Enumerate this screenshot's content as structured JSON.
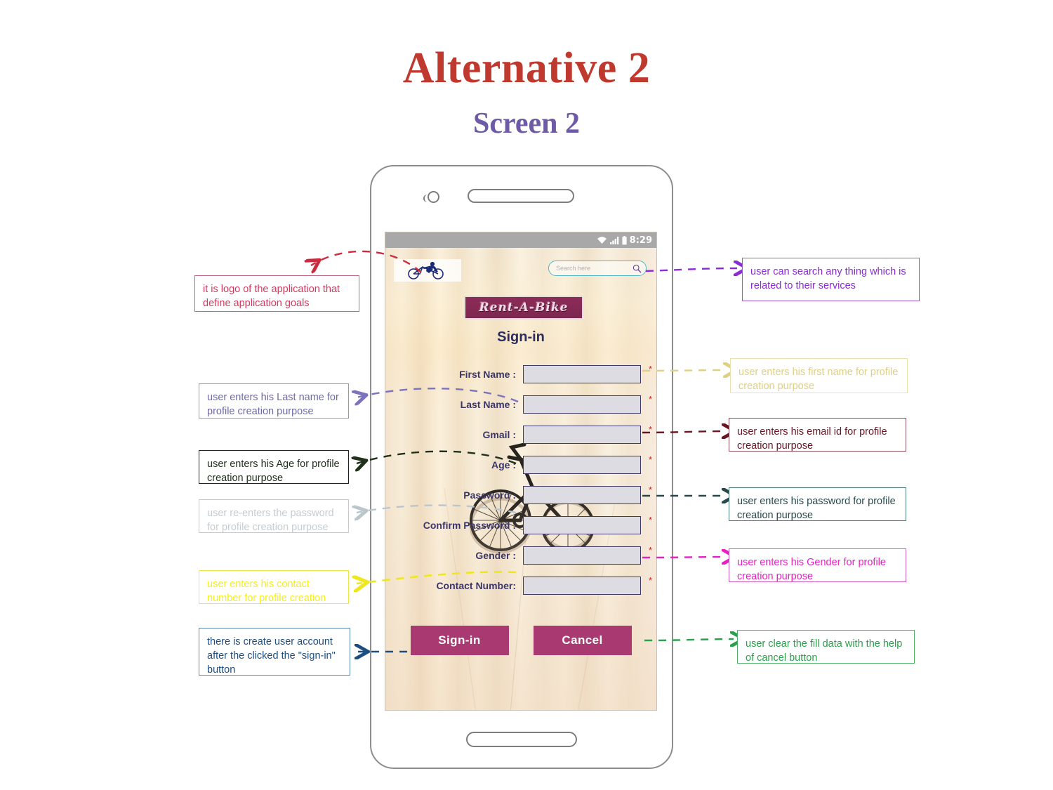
{
  "header": {
    "title": "Alternative 2",
    "subtitle": "Screen 2",
    "title_color": "#c0392f",
    "subtitle_color": "#6f5aa6"
  },
  "phone": {
    "status_bar": {
      "time": "8:29",
      "icons": [
        "wifi-icon",
        "signal-icon",
        "battery-icon"
      ]
    },
    "app": {
      "logo_icon": "bicycle-logo-icon",
      "search": {
        "placeholder": "Search here",
        "icon": "search-icon"
      },
      "banner_title": "Rent-A-Bike",
      "banner_color": "#8d2c58",
      "screen_title": "Sign-in",
      "form_fields": [
        {
          "label": "First Name :",
          "value": "",
          "required": "*"
        },
        {
          "label": "Last Name :",
          "value": "",
          "required": "*"
        },
        {
          "label": "Gmail :",
          "value": "",
          "required": "*"
        },
        {
          "label": "Age :",
          "value": "",
          "required": "*"
        },
        {
          "label": "Password :",
          "value": "",
          "required": "*"
        },
        {
          "label": "Confirm Password :",
          "value": "",
          "required": "*"
        },
        {
          "label": "Gender :",
          "value": "",
          "required": "*"
        },
        {
          "label": "Contact Number:",
          "value": "",
          "required": "*"
        }
      ],
      "buttons": {
        "primary": "Sign-in",
        "secondary": "Cancel",
        "color": "#a83a71"
      }
    }
  },
  "annotations": {
    "left": [
      {
        "id": "logo-note",
        "text": "it is logo of the application that define application goals",
        "text_color": "#d23a5e",
        "border_color": "#c0657e"
      },
      {
        "id": "lastname-note",
        "text": "user enters his Last name for profile creation purpose",
        "text_color": "#6f6aa8",
        "border_color": "#9a9a9a"
      },
      {
        "id": "age-note",
        "text": "user enters his Age for profile creation purpose",
        "text_color": "#22301c",
        "border_color": "#222222"
      },
      {
        "id": "confirm-password-note",
        "text": "user re-enters the password for profile creation purpose",
        "text_color": "#c3cdd3",
        "border_color": "#c9c9c9"
      },
      {
        "id": "contact-note",
        "text": "user enters his contact number for profile creation",
        "text_color": "#f5ef1e",
        "border_color": "#ece646"
      },
      {
        "id": "signin-note",
        "text": "there is create user account after the clicked the \"sign-in\" button",
        "text_color": "#1d4e82",
        "border_color": "#5a86ae"
      }
    ],
    "right": [
      {
        "id": "search-note",
        "text": "user can search any thing which is related to their services",
        "text_color": "#8b2bd6",
        "border_color": "#9b59c9"
      },
      {
        "id": "firstname-note",
        "text": "user enters his first name for profile creation purpose",
        "text_color": "#e0cf85",
        "border_color": "#e8e0ad"
      },
      {
        "id": "email-note",
        "text": "user enters his email id for profile creation purpose",
        "text_color": "#6a1423",
        "border_color": "#8a4a57"
      },
      {
        "id": "password-note",
        "text": "user enters his password for profile creation purpose",
        "text_color": "#27494c",
        "border_color": "#4c7a78"
      },
      {
        "id": "gender-note",
        "text": "user enters his Gender for profile creation purpose",
        "text_color": "#e81fc6",
        "border_color": "#d05cc0"
      },
      {
        "id": "cancel-note",
        "text": "user clear the fill data with the help of cancel button",
        "text_color": "#2aa04a",
        "border_color": "#4fb06a"
      }
    ]
  }
}
